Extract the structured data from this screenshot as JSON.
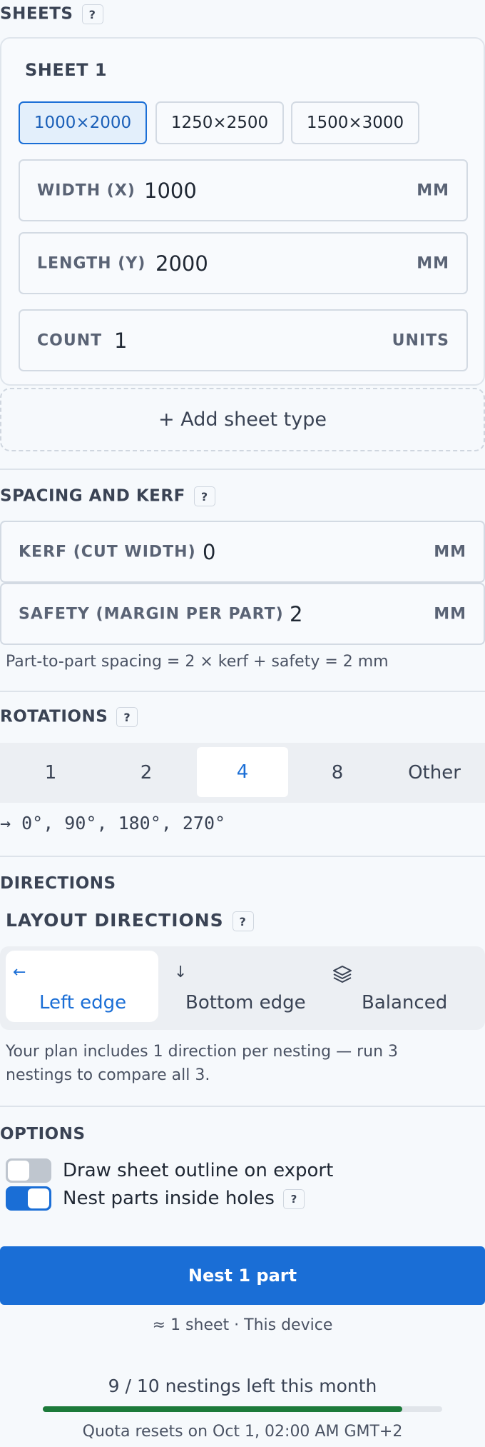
{
  "sheets": {
    "title": "SHEETS",
    "help": "?",
    "sheet_name": "SHEET 1",
    "presets": [
      "1000×2000",
      "1250×2500",
      "1500×3000"
    ],
    "width_label": "WIDTH (X)",
    "width_value": "1000",
    "width_unit": "MM",
    "length_label": "LENGTH (Y)",
    "length_value": "2000",
    "length_unit": "MM",
    "count_label": "COUNT",
    "count_value": "1",
    "count_unit": "UNITS",
    "add_label": "+ Add sheet type"
  },
  "spacing": {
    "title": "SPACING AND KERF",
    "help": "?",
    "kerf_label": "KERF (CUT WIDTH)",
    "kerf_value": "0",
    "kerf_unit": "MM",
    "safety_label": "SAFETY (MARGIN PER PART)",
    "safety_value": "2",
    "safety_unit": "MM",
    "formula": "Part-to-part spacing = 2 × kerf + safety = 2 mm"
  },
  "rotations": {
    "title": "ROTATIONS",
    "help": "?",
    "options": [
      "1",
      "2",
      "4",
      "8",
      "Other"
    ],
    "selected": "4",
    "angles": "→ 0°, 90°, 180°, 270°"
  },
  "directions": {
    "title": "DIRECTIONS",
    "subtitle": "LAYOUT DIRECTIONS",
    "help": "?",
    "options": [
      {
        "label": "Left edge",
        "icon": "arrow-left-icon",
        "glyph": "←"
      },
      {
        "label": "Bottom edge",
        "icon": "arrow-down-icon",
        "glyph": "↓"
      },
      {
        "label": "Balanced",
        "icon": "layers-icon",
        "glyph": ""
      }
    ],
    "selected": "Left edge",
    "note": "Your plan includes 1 direction per nesting — run 3 nestings to compare all 3."
  },
  "options": {
    "title": "OPTIONS",
    "outline_label": "Draw sheet outline on export",
    "outline_on": false,
    "holes_label": "Nest parts inside holes",
    "holes_on": true,
    "help": "?"
  },
  "nest": {
    "button_label": "Nest 1 part",
    "estimate": "≈ 1 sheet · This device"
  },
  "quota": {
    "remaining_text": "9 / 10 nestings left this month",
    "used_fraction": 0.9,
    "reset_text": "Quota resets on Oct 1, 02:00 AM GMT+2"
  },
  "colors": {
    "accent": "#1a6ed6",
    "quota_bar": "#1c7a3a",
    "toggle_off": "#bfc6cf"
  }
}
